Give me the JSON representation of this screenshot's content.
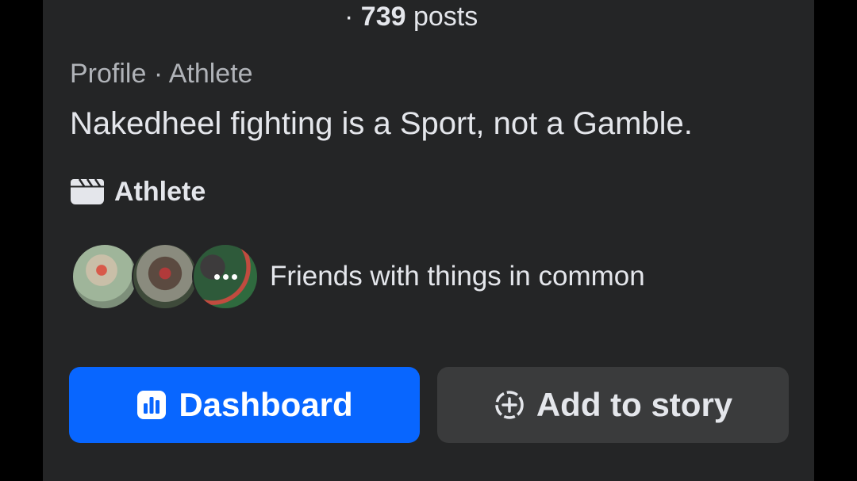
{
  "header": {
    "posts_prefix": "·",
    "posts_count": "739",
    "posts_label": "posts"
  },
  "profile": {
    "meta": "Profile · Athlete",
    "bio": "Nakedheel fighting is a Sport, not a Gamble.",
    "category": "Athlete",
    "category_icon": "clapperboard-icon"
  },
  "friends": {
    "text": "Friends with things in common",
    "more_icon": "more-dots-icon"
  },
  "actions": {
    "dashboard_label": "Dashboard",
    "dashboard_icon": "bar-chart-icon",
    "story_label": "Add to story",
    "story_icon": "add-circle-icon"
  },
  "colors": {
    "background": "#242526",
    "primary_button": "#0866ff",
    "secondary_button": "#3a3b3c",
    "text_primary": "#e4e6eb",
    "text_secondary": "#b0b3b8"
  }
}
